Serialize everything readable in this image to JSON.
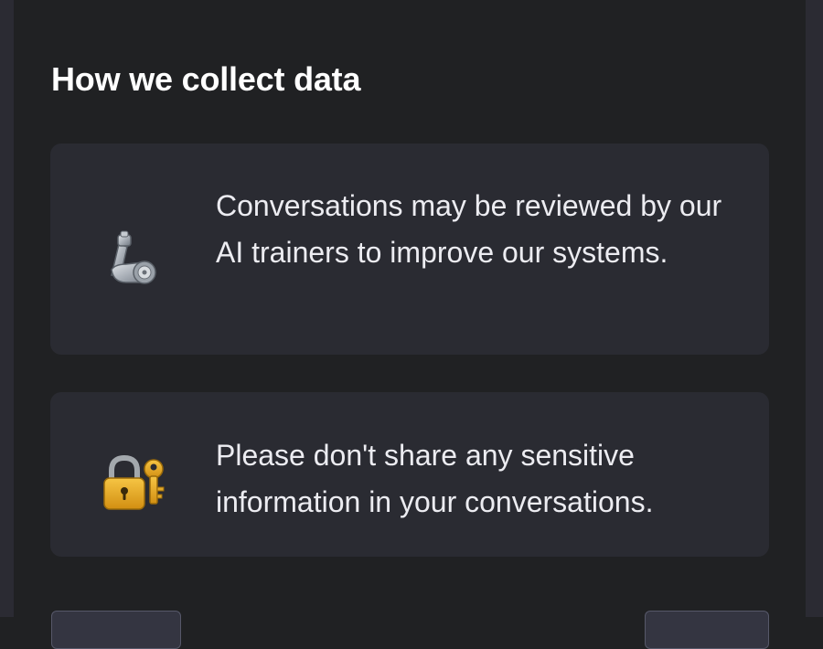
{
  "dialog": {
    "title": "How we collect data",
    "cards": [
      {
        "icon": "mechanical-arm-icon",
        "text": "Conversations may be reviewed by our AI trainers to improve our systems."
      },
      {
        "icon": "lock-with-key-icon",
        "text": "Please don't share any sensitive information in your conversations."
      }
    ]
  },
  "colors": {
    "background": "#202123",
    "card": "#2a2b32",
    "title_text": "#ffffff",
    "body_text": "#ececf1"
  }
}
